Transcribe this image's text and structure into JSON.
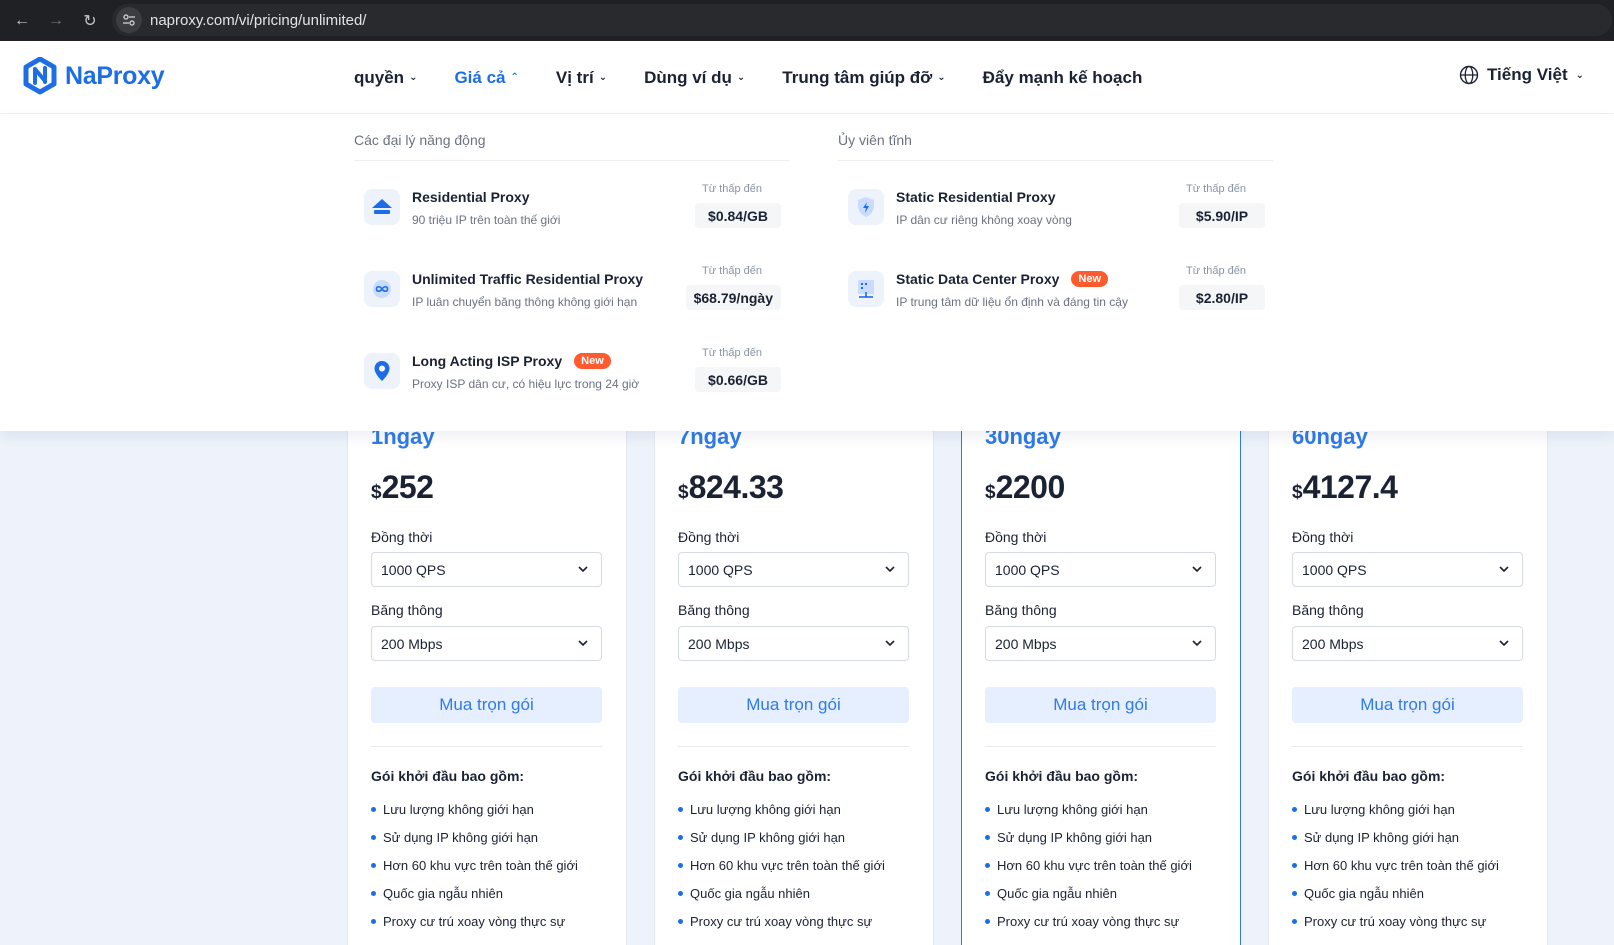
{
  "browser": {
    "url": "naproxy.com/vi/pricing/unlimited/"
  },
  "brand": {
    "name": "NaProxy",
    "color": "#1d6ee6"
  },
  "nav": {
    "items": [
      {
        "label": "quyền",
        "has_menu": true
      },
      {
        "label": "Giá cả",
        "has_menu": true,
        "active": true
      },
      {
        "label": "Vị trí",
        "has_menu": true
      },
      {
        "label": "Dùng ví dụ",
        "has_menu": true
      },
      {
        "label": "Trung tâm giúp đỡ",
        "has_menu": true
      },
      {
        "label": "Đẩy mạnh kế hoạch",
        "has_menu": false
      }
    ],
    "language": "Tiếng Việt"
  },
  "dropdown": {
    "left_title": "Các đại lý năng động",
    "right_title": "Ủy viên tĩnh",
    "from_label": "Từ thấp đến",
    "new_label": "New",
    "left": [
      {
        "name": "Residential Proxy",
        "desc": "90 triệu IP trên toàn thế giới",
        "price": "$0.84/GB",
        "icon": "home-icon",
        "is_new": false
      },
      {
        "name": "Unlimited Traffic Residential Proxy",
        "desc": "IP luân chuyển băng thông không giới hạn",
        "price": "$68.79/ngày",
        "icon": "infinity-icon",
        "is_new": false
      },
      {
        "name": "Long Acting ISP Proxy",
        "desc": "Proxy ISP dân cư, có hiệu lực trong 24 giờ",
        "price": "$0.66/GB",
        "icon": "location-pin-icon",
        "is_new": true
      }
    ],
    "right": [
      {
        "name": "Static Residential Proxy",
        "desc": "IP dân cư riêng không xoay vòng",
        "price": "$5.90/IP",
        "icon": "shield-icon",
        "is_new": false
      },
      {
        "name": "Static Data Center Proxy",
        "desc": "IP trung tâm dữ liệu ổn định và đáng tin cậy",
        "price": "$2.80/IP",
        "icon": "server-icon",
        "is_new": true
      }
    ]
  },
  "plans": {
    "concurrency_label": "Đồng thời",
    "bandwidth_label": "Băng thông",
    "buy_label": "Mua trọn gói",
    "includes_title": "Gói khởi đầu bao gồm:",
    "features": [
      "Lưu lượng không giới hạn",
      "Sử dụng IP không giới hạn",
      "Hơn 60 khu vực trên toàn thế giới",
      "Quốc gia ngẫu nhiên",
      "Proxy cư trú xoay vòng thực sự"
    ],
    "cards": [
      {
        "duration": "1ngày",
        "currency": "$",
        "price": "252",
        "concurrency": "1000 QPS",
        "bandwidth": "200 Mbps",
        "highlight": false
      },
      {
        "duration": "7ngày",
        "currency": "$",
        "price": "824.33",
        "concurrency": "1000 QPS",
        "bandwidth": "200 Mbps",
        "highlight": false
      },
      {
        "duration": "30ngày",
        "currency": "$",
        "price": "2200",
        "concurrency": "1000 QPS",
        "bandwidth": "200 Mbps",
        "highlight": true
      },
      {
        "duration": "60ngày",
        "currency": "$",
        "price": "4127.4",
        "concurrency": "1000 QPS",
        "bandwidth": "200 Mbps",
        "highlight": false
      }
    ]
  },
  "colors": {
    "accent": "#2f7bea",
    "badge": "#ff5b2e",
    "page_bg": "#eef3fb"
  }
}
